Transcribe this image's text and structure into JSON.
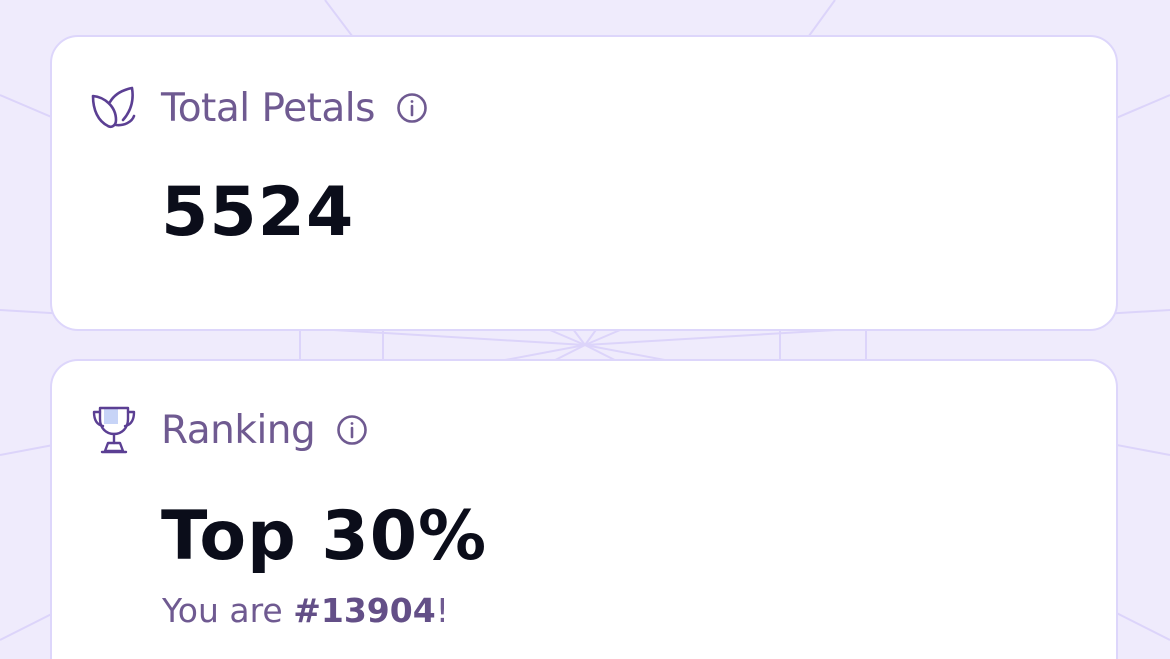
{
  "cards": {
    "total_petals": {
      "icon": "leaf-icon",
      "title": "Total Petals",
      "info_icon": "info-icon",
      "value": "5524"
    },
    "ranking": {
      "icon": "trophy-icon",
      "title": "Ranking",
      "info_icon": "info-icon",
      "value": "Top 30%",
      "sub_prefix": "You are ",
      "sub_rank": "#13904",
      "sub_suffix": "!"
    }
  },
  "colors": {
    "background": "#efebfc",
    "card": "#ffffff",
    "card_border": "#ddd6fb",
    "title_text": "#6f5a91",
    "value_text": "#0b0d1a",
    "icon_stroke": "#5b3f93"
  }
}
